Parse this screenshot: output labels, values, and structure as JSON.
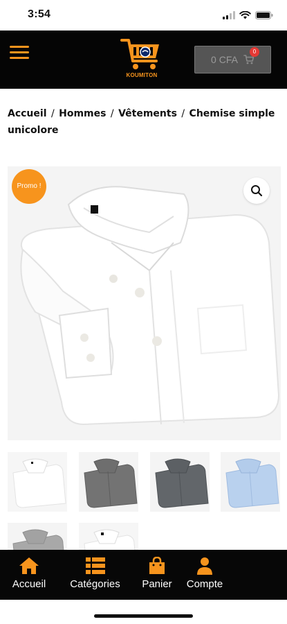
{
  "status_bar": {
    "time": "3:54"
  },
  "header": {
    "logo_text": "KOUMITON",
    "cart_total": "0 CFA",
    "cart_count": "0",
    "accent_color": "#f7941d"
  },
  "breadcrumb": {
    "items": [
      "Accueil",
      "Hommes",
      "Vêtements"
    ],
    "current": "Chemise simple unicolore"
  },
  "product": {
    "badge": "Promo !",
    "thumbnails": [
      "white-shirt",
      "dark-grey-shirt",
      "grey-shirt",
      "light-blue-shirt",
      "light-grey-shirt",
      "white-shirt-alt"
    ]
  },
  "bottom_nav": {
    "items": [
      {
        "label": "Accueil",
        "icon": "home-icon"
      },
      {
        "label": "Catégories",
        "icon": "list-icon"
      },
      {
        "label": "Panier",
        "icon": "bag-icon"
      },
      {
        "label": "Compte",
        "icon": "user-icon"
      }
    ]
  }
}
